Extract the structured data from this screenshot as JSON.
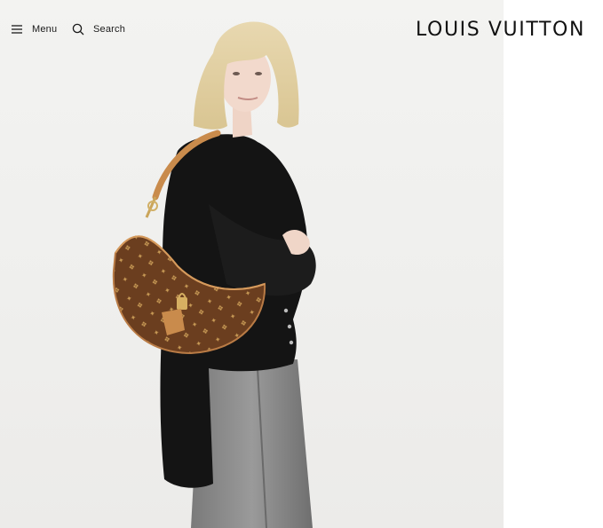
{
  "header": {
    "menu_label": "Menu",
    "search_label": "Search",
    "brand": "LOUIS VUITTON"
  },
  "hero": {
    "image_description": "model-with-monogram-shoulder-bag"
  },
  "colors": {
    "hero_background": "#efefed",
    "text": "#1a1a1a",
    "monogram_brown": "#6b3e1f",
    "leather_tan": "#c98b4c"
  }
}
